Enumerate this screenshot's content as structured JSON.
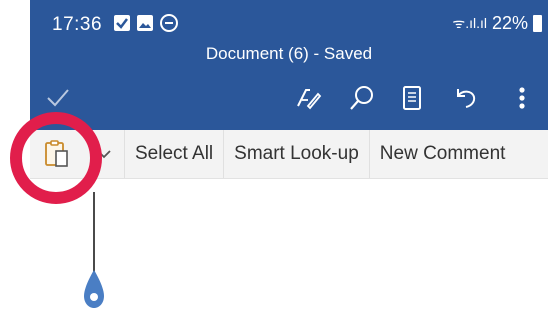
{
  "status_bar": {
    "time": "17:36",
    "signal": "ᯤ.ıl.ıl",
    "battery": "22%"
  },
  "header": {
    "title": "Document (6) - Saved"
  },
  "toolbar": {
    "icons": [
      "checkmark-icon",
      "pen-icon",
      "search-icon",
      "reading-view-icon",
      "undo-icon",
      "more-icon"
    ]
  },
  "context_menu": {
    "items": [
      {
        "label": "Select All"
      },
      {
        "label": "Smart Look-up"
      },
      {
        "label": "New Comment"
      }
    ]
  },
  "colors": {
    "header_bg": "#2b579a",
    "highlight_ring": "#e11e4b",
    "handle": "#4a7ec4"
  }
}
